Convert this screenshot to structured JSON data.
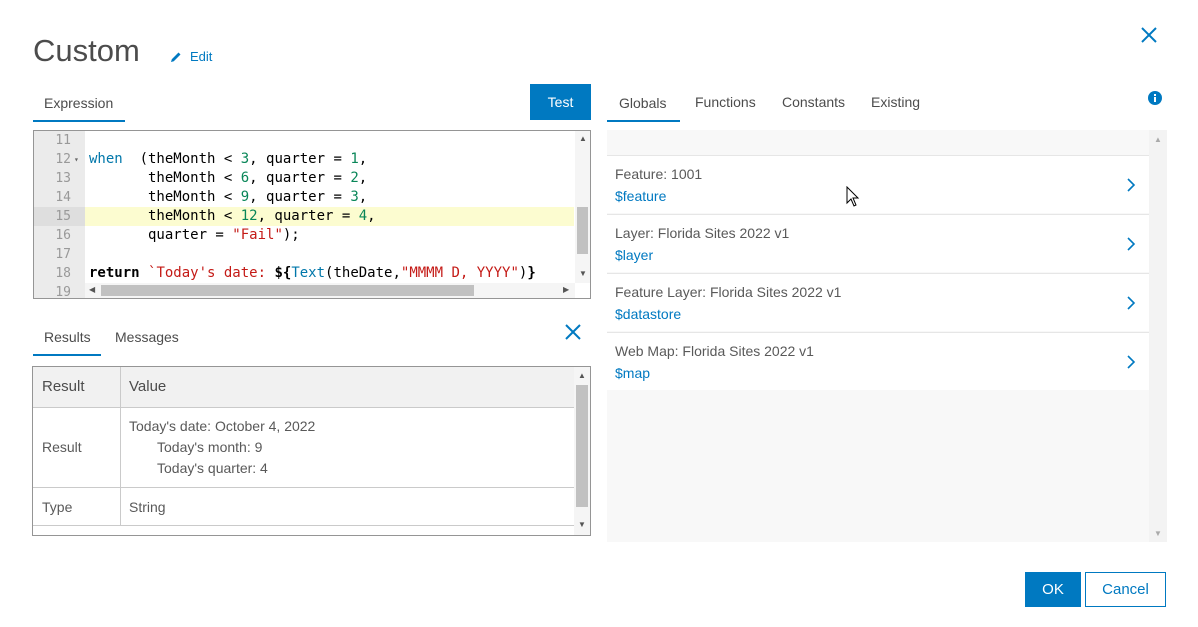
{
  "dialog": {
    "title": "Custom",
    "edit_label": "Edit",
    "accent_color": "#0079c1"
  },
  "expression_panel": {
    "tab_label": "Expression",
    "test_label": "Test",
    "code_lines": [
      {
        "num": "11",
        "tokens": []
      },
      {
        "num": "12",
        "fold": true,
        "tokens": [
          [
            "kw",
            "when"
          ],
          [
            "",
            "  (theMonth < "
          ],
          [
            "num",
            "3"
          ],
          [
            "",
            ", quarter = "
          ],
          [
            "num",
            "1"
          ],
          [
            "",
            ","
          ]
        ]
      },
      {
        "num": "13",
        "tokens": [
          [
            "",
            "       theMonth < "
          ],
          [
            "num",
            "6"
          ],
          [
            "",
            ", quarter = "
          ],
          [
            "num",
            "2"
          ],
          [
            "",
            ","
          ]
        ]
      },
      {
        "num": "14",
        "tokens": [
          [
            "",
            "       theMonth < "
          ],
          [
            "num",
            "9"
          ],
          [
            "",
            ", quarter = "
          ],
          [
            "num",
            "3"
          ],
          [
            "",
            ","
          ]
        ]
      },
      {
        "num": "15",
        "highlight": true,
        "tokens": [
          [
            "",
            "       theMonth < "
          ],
          [
            "num",
            "12"
          ],
          [
            "",
            ", quarter = "
          ],
          [
            "num",
            "4"
          ],
          [
            "",
            ","
          ]
        ]
      },
      {
        "num": "16",
        "tokens": [
          [
            "",
            "       quarter = "
          ],
          [
            "str",
            "\"Fail\""
          ],
          [
            "",
            ");"
          ]
        ]
      },
      {
        "num": "17",
        "tokens": []
      },
      {
        "num": "18",
        "tokens": [
          [
            "kwb",
            "return"
          ],
          [
            "",
            " "
          ],
          [
            "str",
            "`Today's date: "
          ],
          [
            "kwb",
            "${"
          ],
          [
            "fn",
            "Text"
          ],
          [
            "",
            "(theDate,"
          ],
          [
            "str",
            "\"MMMM D, YYYY\""
          ],
          [
            "",
            ")"
          ],
          [
            "kwb",
            "}"
          ]
        ]
      },
      {
        "num": "19",
        "tokens": []
      }
    ]
  },
  "results_panel": {
    "tabs": [
      "Results",
      "Messages"
    ],
    "headers": {
      "result": "Result",
      "value": "Value"
    },
    "rows": [
      {
        "key": "Result",
        "lines": [
          "Today's date: October 4, 2022",
          "Today's month: 9",
          "Today's quarter: 4"
        ]
      },
      {
        "key": "Type",
        "lines": [
          "String"
        ]
      }
    ]
  },
  "globals_panel": {
    "tabs": [
      "Globals",
      "Functions",
      "Constants",
      "Existing"
    ],
    "items": [
      {
        "label": "Feature: 1001",
        "var": "$feature"
      },
      {
        "label": "Layer: Florida Sites 2022 v1",
        "var": "$layer"
      },
      {
        "label": "Feature Layer: Florida Sites 2022 v1",
        "var": "$datastore"
      },
      {
        "label": "Web Map: Florida Sites 2022 v1",
        "var": "$map"
      }
    ]
  },
  "footer": {
    "ok_label": "OK",
    "cancel_label": "Cancel"
  }
}
